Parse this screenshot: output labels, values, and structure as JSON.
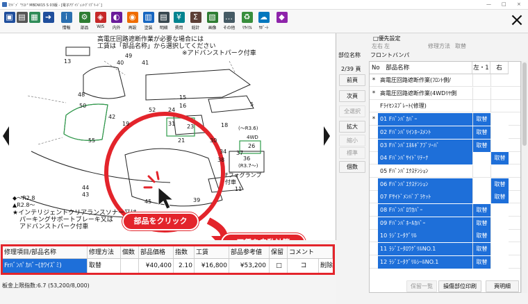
{
  "titlebar": {
    "text": "ﾏﾂﾄﾞｧﾞ \"ﾃｽﾄ\" MBDW15 S 03版 - [電子ｱｸﾞｲｼﾞｪﾝﾄｸﾞﾘﾌﾟﾘｰﾄﾞ]",
    "min": "—",
    "max": "□",
    "close": "×"
  },
  "toolbar": {
    "buttons": [
      {
        "name": "save-icon",
        "label": "",
        "color": "#1f4e9c",
        "glyph": "▣"
      },
      {
        "name": "print-icon",
        "label": "",
        "color": "#555555",
        "glyph": "▤"
      },
      {
        "name": "page-icon",
        "label": "",
        "color": "#2e8b57",
        "glyph": "▦"
      },
      {
        "name": "exit-icon",
        "label": "",
        "color": "#1f4e9c",
        "glyph": "➜"
      },
      {
        "name": "info-icon",
        "label": "情報",
        "color": "#2a6fb0",
        "glyph": "ｉ"
      },
      {
        "name": "parts-icon",
        "label": "部品",
        "color": "#2e7d32",
        "glyph": "⚙"
      },
      {
        "name": "ws-icon",
        "label": "W/S",
        "color": "#c62828",
        "glyph": "◈"
      },
      {
        "name": "inner-icon",
        "label": "内外",
        "color": "#6a1b9a",
        "glyph": "◐"
      },
      {
        "name": "special-icon",
        "label": "再設",
        "color": "#ef6c00",
        "glyph": "◉"
      },
      {
        "name": "paint-icon",
        "label": "塗装",
        "color": "#1565c0",
        "glyph": "▥"
      },
      {
        "name": "detail-icon",
        "label": "明細",
        "color": "#37474f",
        "glyph": "▤"
      },
      {
        "name": "cost-icon",
        "label": "費用",
        "color": "#00838f",
        "glyph": "¥"
      },
      {
        "name": "total-icon",
        "label": "総計",
        "color": "#5d4037",
        "glyph": "Σ"
      },
      {
        "name": "image-icon",
        "label": "画像",
        "color": "#2e7d32",
        "glyph": "▧"
      },
      {
        "name": "other-icon",
        "label": "その他",
        "color": "#455a64",
        "glyph": "…"
      },
      {
        "name": "recycle-icon",
        "label": "ﾘｻｲｸﾙ",
        "color": "#388e3c",
        "glyph": "♻"
      },
      {
        "name": "support-icon",
        "label": "ｻﾎﾟｰﾄ",
        "color": "#0277bd",
        "glyph": "☁"
      },
      {
        "name": "diamond-icon",
        "label": "",
        "color": "#8e24aa",
        "glyph": "◆"
      }
    ],
    "close_glyph": "×"
  },
  "diagram": {
    "note1": "高電圧回路遮断作業が必要な場合には",
    "note2": "工賃は「部品名称」から選択してください",
    "note3": "※アドバンストパーク付車",
    "note_bottom1": "★インテリジェントクリアランスソナー又は",
    "note_bottom2": "パーキングサポートブレーキ又は",
    "note_bottom3": "アドバンストパーク付車",
    "fog1": "Fフォグランプ",
    "fog2": "付車",
    "label_r36": "(〜R3.6)",
    "label_r37": "(R3.7〜)",
    "label_4wd": "4WD",
    "legend1": "◆〜R2.8",
    "legend2": "▲R2.8〜",
    "numbers": [
      "13",
      "49",
      "40",
      "41",
      "48",
      "50",
      "42",
      "55",
      "19",
      "31",
      "23",
      "21",
      "30",
      "26",
      "34",
      "37",
      "36",
      "38",
      "24",
      "18",
      "15",
      "16",
      "52",
      "44",
      "43",
      "45",
      "39",
      "11",
      "5"
    ],
    "callout_click": "部品をクリック",
    "callout_auto": "工賃を自動計算"
  },
  "grid": {
    "headers": [
      "修理項目/部品名称",
      "修理方法",
      "個数",
      "部品価格",
      "指数",
      "工賃",
      "部品参考値",
      "保留",
      "コメント"
    ],
    "row": {
      "name": "Frﾊﾞﾝﾊﾟｶﾊﾞｰ(ｶﾜｲｽﾞﾐ)",
      "method": "取替",
      "qty": "",
      "price": "¥40,400",
      "index": "2.10",
      "labor": "¥16,800",
      "ref": "¥53,200",
      "hold": "□",
      "comment": "コ",
      "delete": "削除"
    },
    "limit": "板金上限指数:6.7 (53,200/8,000)"
  },
  "right": {
    "priority_label": "□優先設定",
    "lr_label": "左右",
    "lr_value": "左",
    "method_label": "修理方法",
    "method_value": "取替",
    "part_name_label": "部位名称",
    "part_name_value": "フロントバンパ",
    "page_label": "2/39 頁",
    "col_no": "No",
    "col_name": "部品名称",
    "col_left": "左・1",
    "col_right": "右",
    "buttons": {
      "prev": "前頁",
      "next": "次頁",
      "select_all": "全選択",
      "zoom_in": "拡大",
      "zoom_out": "縮小",
      "standard": "標準",
      "count": "個数"
    },
    "rows": [
      {
        "mark": "*",
        "name": "高電圧回路遮断作業(ﾌﾛﾝﾄ側/",
        "left": "",
        "right": "",
        "sel": false,
        "lon": false,
        "ron": false
      },
      {
        "mark": "*",
        "name": "高電圧回路遮断作業(4WDﾘﾔ側",
        "left": "",
        "right": "",
        "sel": false,
        "lon": false,
        "ron": false
      },
      {
        "mark": "",
        "name": "Fﾗｲｾﾝｽﾌﾟﾚｰﾄ(修理)",
        "left": "",
        "right": "",
        "sel": false,
        "lon": false,
        "ron": false
      },
      {
        "mark": "*",
        "name": "01 Fﾊﾞﾝﾊﾟｶﾊﾞｰ",
        "left": "取替",
        "right": "",
        "sel": true,
        "lon": true,
        "ron": false
      },
      {
        "mark": "",
        "name": "02 Fﾊﾞﾝﾊﾟﾘｲﾝﾎｰｽﾒﾝﾄ",
        "left": "取替",
        "right": "",
        "sel": true,
        "lon": true,
        "ron": false
      },
      {
        "mark": "",
        "name": "03 Fﾊﾞﾝﾊﾟｴﾈﾙｷﾞｱﾌﾞｿｰﾊﾞ",
        "left": "取替",
        "right": "",
        "sel": true,
        "lon": true,
        "ron": false
      },
      {
        "mark": "",
        "name": "04 Fﾊﾞﾝﾊﾟｻｲﾄﾞﾘﾃｰﾅ",
        "left": "",
        "right": "取替",
        "sel": true,
        "lon": false,
        "ron": true
      },
      {
        "mark": "",
        "name": "05 Fﾊﾞﾝﾊﾟｴｸｽﾃﾝｼｮﾝ",
        "left": "",
        "right": "",
        "sel": false,
        "lon": false,
        "ron": false
      },
      {
        "mark": "",
        "name": "06 Fﾊﾞﾝﾊﾟｴｸｽﾃﾝｼｮﾝ",
        "left": "",
        "right": "取替",
        "sel": true,
        "lon": false,
        "ron": true
      },
      {
        "mark": "",
        "name": "07 Fｻｲﾄﾞﾒﾝﾊﾞﾌﾞﾗｹｯﾄ",
        "left": "",
        "right": "取替",
        "sel": true,
        "lon": false,
        "ron": true
      },
      {
        "mark": "",
        "name": "08 Fﾊﾞﾝﾊﾟﾛﾜｶﾊﾞｰ",
        "left": "取替",
        "right": "",
        "sel": true,
        "lon": true,
        "ron": false
      },
      {
        "mark": "",
        "name": "09 Fﾊﾞﾝﾊﾟﾎｰﾙｶﾊﾞｰ",
        "left": "取替",
        "right": "",
        "sel": true,
        "lon": true,
        "ron": false
      },
      {
        "mark": "",
        "name": "10 ﾗｼﾞｴｰﾀｸﾞﾘﾙ",
        "left": "取替",
        "right": "",
        "sel": true,
        "lon": true,
        "ron": false
      },
      {
        "mark": "",
        "name": "11 ﾗｼﾞｴｰﾀﾛﾜｸﾞﾘﾙNO.1",
        "left": "取替",
        "right": "",
        "sel": true,
        "lon": true,
        "ron": false
      },
      {
        "mark": "",
        "name": "12 ﾗｼﾞｴｰﾀｸﾞﾘﾙｼｰﾙNO.1",
        "left": "取替",
        "right": "",
        "sel": true,
        "lon": true,
        "ron": false
      }
    ],
    "bottom": {
      "hold_list": "保留一覧",
      "print_damage": "損傷部位印刷",
      "detail_view": "頁明細"
    }
  },
  "colors": {
    "accent_red": "#e3242b",
    "select_blue": "#1e6fd9"
  }
}
